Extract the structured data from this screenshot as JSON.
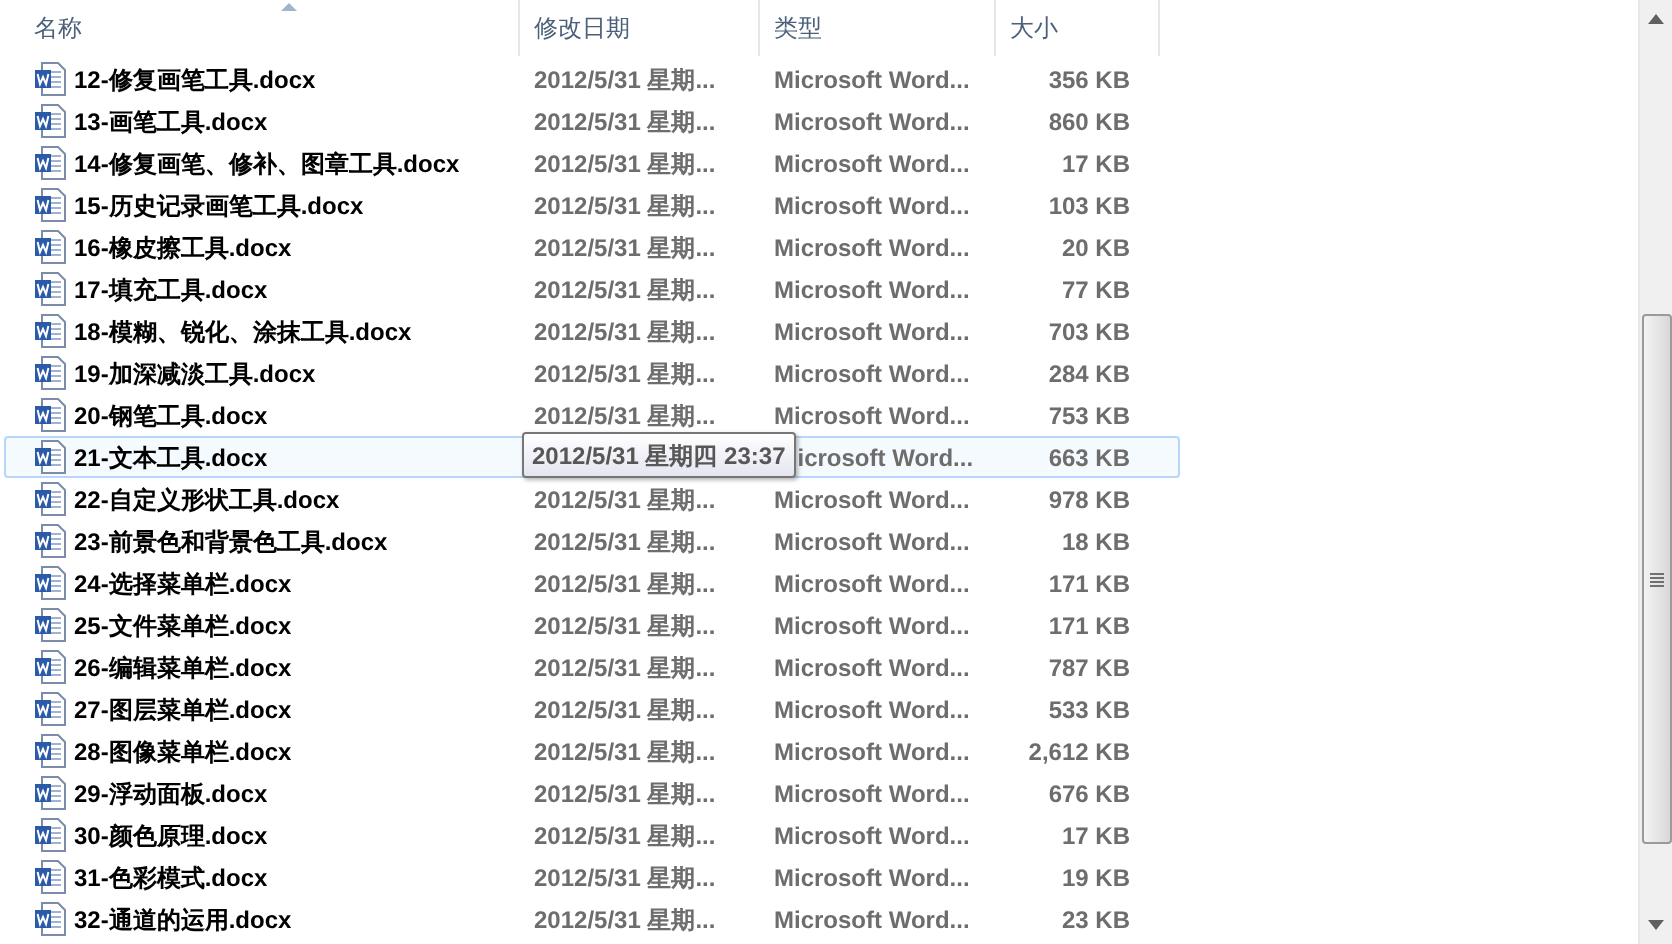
{
  "columns": [
    {
      "label": "名称",
      "sorted": true
    },
    {
      "label": "修改日期",
      "sorted": false
    },
    {
      "label": "类型",
      "sorted": false
    },
    {
      "label": "大小",
      "sorted": false
    }
  ],
  "files": [
    {
      "name": "12-修复画笔工具.docx",
      "date": "2012/5/31 星期...",
      "type": "Microsoft Word...",
      "size": "356 KB",
      "hovered": false
    },
    {
      "name": "13-画笔工具.docx",
      "date": "2012/5/31 星期...",
      "type": "Microsoft Word...",
      "size": "860 KB",
      "hovered": false
    },
    {
      "name": "14-修复画笔、修补、图章工具.docx",
      "date": "2012/5/31 星期...",
      "type": "Microsoft Word...",
      "size": "17 KB",
      "hovered": false
    },
    {
      "name": "15-历史记录画笔工具.docx",
      "date": "2012/5/31 星期...",
      "type": "Microsoft Word...",
      "size": "103 KB",
      "hovered": false
    },
    {
      "name": "16-橡皮擦工具.docx",
      "date": "2012/5/31 星期...",
      "type": "Microsoft Word...",
      "size": "20 KB",
      "hovered": false
    },
    {
      "name": "17-填充工具.docx",
      "date": "2012/5/31 星期...",
      "type": "Microsoft Word...",
      "size": "77 KB",
      "hovered": false
    },
    {
      "name": "18-模糊、锐化、涂抹工具.docx",
      "date": "2012/5/31 星期...",
      "type": "Microsoft Word...",
      "size": "703 KB",
      "hovered": false
    },
    {
      "name": "19-加深减淡工具.docx",
      "date": "2012/5/31 星期...",
      "type": "Microsoft Word...",
      "size": "284 KB",
      "hovered": false
    },
    {
      "name": "20-钢笔工具.docx",
      "date": "2012/5/31 星期...",
      "type": "Microsoft Word...",
      "size": "753 KB",
      "hovered": false
    },
    {
      "name": "21-文本工具.docx",
      "tooltip": "2012/5/31 星期四 23:37",
      "type": "icrosoft Word...",
      "size": "663 KB",
      "hovered": true
    },
    {
      "name": "22-自定义形状工具.docx",
      "date": "2012/5/31 星期...",
      "type": "Microsoft Word...",
      "size": "978 KB",
      "hovered": false
    },
    {
      "name": "23-前景色和背景色工具.docx",
      "date": "2012/5/31 星期...",
      "type": "Microsoft Word...",
      "size": "18 KB",
      "hovered": false
    },
    {
      "name": "24-选择菜单栏.docx",
      "date": "2012/5/31 星期...",
      "type": "Microsoft Word...",
      "size": "171 KB",
      "hovered": false
    },
    {
      "name": "25-文件菜单栏.docx",
      "date": "2012/5/31 星期...",
      "type": "Microsoft Word...",
      "size": "171 KB",
      "hovered": false
    },
    {
      "name": "26-编辑菜单栏.docx",
      "date": "2012/5/31 星期...",
      "type": "Microsoft Word...",
      "size": "787 KB",
      "hovered": false
    },
    {
      "name": "27-图层菜单栏.docx",
      "date": "2012/5/31 星期...",
      "type": "Microsoft Word...",
      "size": "533 KB",
      "hovered": false
    },
    {
      "name": "28-图像菜单栏.docx",
      "date": "2012/5/31 星期...",
      "type": "Microsoft Word...",
      "size": "2,612 KB",
      "hovered": false
    },
    {
      "name": "29-浮动面板.docx",
      "date": "2012/5/31 星期...",
      "type": "Microsoft Word...",
      "size": "676 KB",
      "hovered": false
    },
    {
      "name": "30-颜色原理.docx",
      "date": "2012/5/31 星期...",
      "type": "Microsoft Word...",
      "size": "17 KB",
      "hovered": false
    },
    {
      "name": "31-色彩模式.docx",
      "date": "2012/5/31 星期...",
      "type": "Microsoft Word...",
      "size": "19 KB",
      "hovered": false
    },
    {
      "name": "32-通道的运用.docx",
      "date": "2012/5/31 星期...",
      "type": "Microsoft Word...",
      "size": "23 KB",
      "hovered": false
    }
  ]
}
